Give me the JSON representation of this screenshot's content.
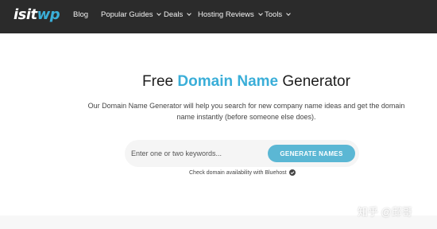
{
  "brand": {
    "logo_main": "isit",
    "logo_accent": "wp",
    "accent_color": "#3aaed8"
  },
  "nav": {
    "items": [
      {
        "label": "Blog",
        "has_dropdown": false
      },
      {
        "label": "Popular Guides",
        "has_dropdown": true
      },
      {
        "label": "Deals",
        "has_dropdown": true
      },
      {
        "label": "Hosting Reviews",
        "has_dropdown": true
      },
      {
        "label": "Tools",
        "has_dropdown": true
      }
    ]
  },
  "hero": {
    "title_prefix": "Free ",
    "title_accent": "Domain Name",
    "title_suffix": " Generator",
    "description": "Our Domain Name Generator will help you search for new company name ideas and get the domain name instantly (before someone else does)."
  },
  "search": {
    "placeholder": "Enter one or two keywords...",
    "value": "",
    "button_label": "GENERATE NAMES",
    "button_color": "#5bb7d4"
  },
  "note": {
    "text": "Check domain availability with Bluehost",
    "icon": "check-circle-icon"
  },
  "watermark": {
    "text": "知乎 @邱哥"
  }
}
